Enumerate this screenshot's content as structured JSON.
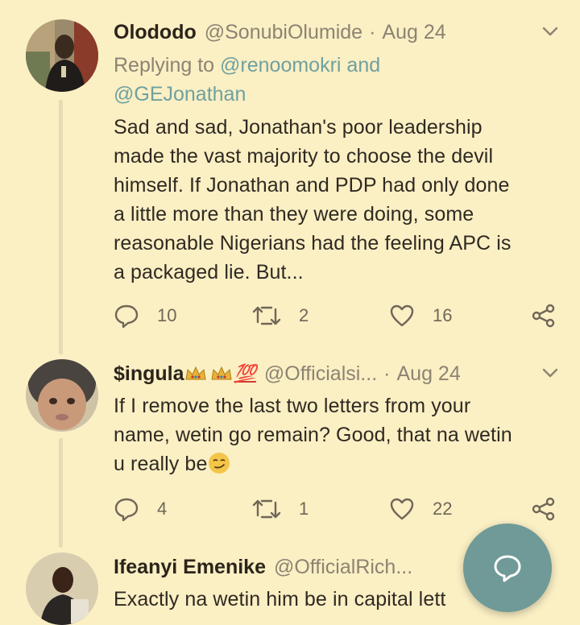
{
  "tweets": [
    {
      "name": "Olododo",
      "handle": "@SonubiOlumide",
      "time": "Aug 24",
      "replying_prefix": "Replying to",
      "replying_to_1": "@renoomokri",
      "replying_and": "and",
      "replying_to_2": "@GEJonathan",
      "text_lines": [
        "Sad and sad, Jonathan's poor leadership",
        "made the vast majority to choose the devil",
        "himself. If Jonathan and PDP had only done",
        "a little more than they were doing, some",
        "reasonable Nigerians had the feeling APC is",
        "a packaged lie. But..."
      ],
      "replies": "10",
      "retweets": "2",
      "likes": "16"
    },
    {
      "name": "$ingula",
      "name_emoji_text": "💯",
      "handle": "@Officialsi...",
      "time": "Aug 24",
      "text_lines": [
        "If I remove the last two letters from your",
        "name, wetin go remain? Good, that na wetin",
        "u really be"
      ],
      "replies": "4",
      "retweets": "1",
      "likes": "22"
    },
    {
      "name": "Ifeanyi Emenike",
      "handle": "@OfficialRich...",
      "text_lines": [
        "Exactly na wetin him be in capital lett"
      ]
    }
  ],
  "icons": {
    "caret": "chevron-down-icon",
    "reply": "reply-icon",
    "retweet": "retweet-icon",
    "like": "heart-icon",
    "share": "share-icon",
    "fab": "compose-reply-icon"
  },
  "colors": {
    "background": "#fbefc4",
    "accent": "#6fa1a0",
    "fab": "#6f9a97"
  }
}
